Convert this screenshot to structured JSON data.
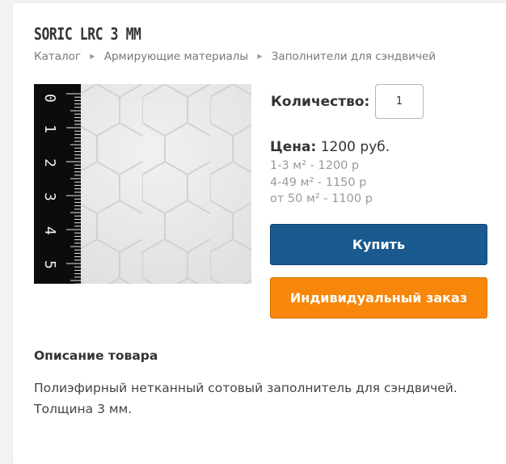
{
  "product": {
    "title": "SORIC LRC 3 MM",
    "image_alt": "Soric LRC 3 mm"
  },
  "breadcrumb": [
    {
      "label": "Каталог"
    },
    {
      "label": "Армирующие материалы"
    },
    {
      "label": "Заполнители для сэндвичей"
    }
  ],
  "ruler_digits": [
    "0",
    "1",
    "2",
    "3",
    "4",
    "5"
  ],
  "quantity": {
    "label": "Количество:",
    "value": "1"
  },
  "price": {
    "label": "Цена:",
    "value": "1200 руб.",
    "tiers": [
      "1-3 м² - 1200 р",
      "4-49 м² - 1150 р",
      "от 50 м² - 1100 р"
    ]
  },
  "buttons": {
    "buy": "Купить",
    "custom_order": "Индивидуальный заказ"
  },
  "description": {
    "title": "Описание товара",
    "lines": [
      "Полиэфирный нетканный сотовый заполнитель для сэндвичей.",
      "Толщина 3 мм."
    ]
  },
  "colors": {
    "buy_button": "#1a5a8e",
    "order_button": "#f7870b"
  },
  "icons": {
    "breadcrumb_separator": "chevron-right-icon"
  }
}
